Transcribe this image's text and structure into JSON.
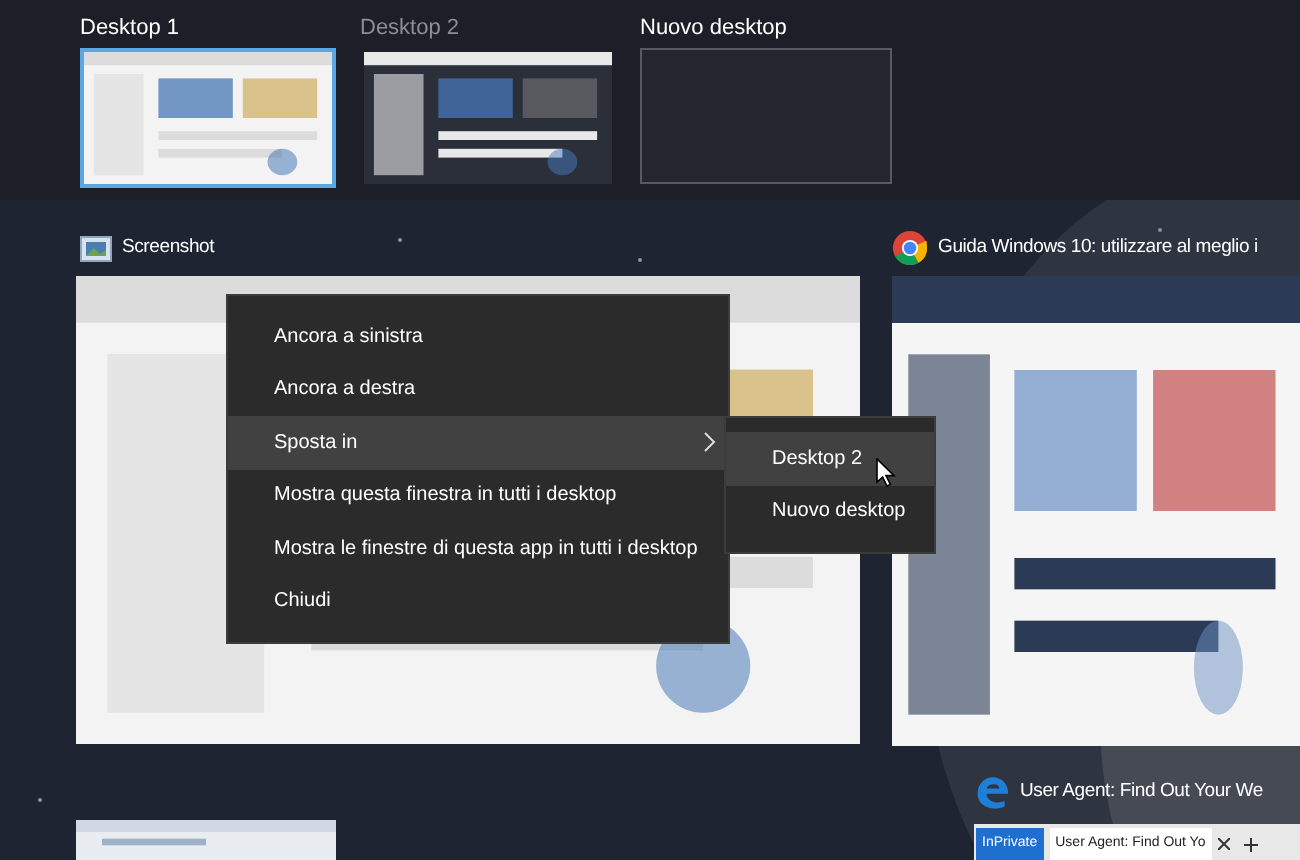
{
  "desktops": [
    {
      "label": "Desktop 1",
      "kind": "desktop",
      "selected": true
    },
    {
      "label": "Desktop 2",
      "kind": "desktop",
      "selected": false
    },
    {
      "label": "Nuovo desktop",
      "kind": "new"
    }
  ],
  "windows": [
    {
      "title": "Screenshot",
      "kind": "explorer"
    },
    {
      "title": "Guida Windows 10: utilizzare al meglio i",
      "kind": "chrome"
    },
    {
      "title": "User Agent: Find Out Your We",
      "kind": "edge",
      "tabs": [
        "InPrivate",
        "User Agent: Find Out Yo"
      ]
    }
  ],
  "context_menu": {
    "items": [
      {
        "label": "Ancora a sinistra",
        "selected": false,
        "submenu": false
      },
      {
        "label": "Ancora a destra",
        "selected": false,
        "submenu": false
      },
      {
        "label": "Sposta in",
        "selected": true,
        "submenu": true
      },
      {
        "label": "Mostra questa finestra in tutti i desktop",
        "selected": false,
        "submenu": false
      },
      {
        "label": "Mostra le finestre di questa app in tutti i desktop",
        "selected": false,
        "submenu": false
      },
      {
        "label": "Chiudi",
        "selected": false,
        "submenu": false
      }
    ],
    "submenu": [
      {
        "label": "Desktop 2",
        "selected": true
      },
      {
        "label": "Nuovo desktop",
        "selected": false
      }
    ]
  }
}
